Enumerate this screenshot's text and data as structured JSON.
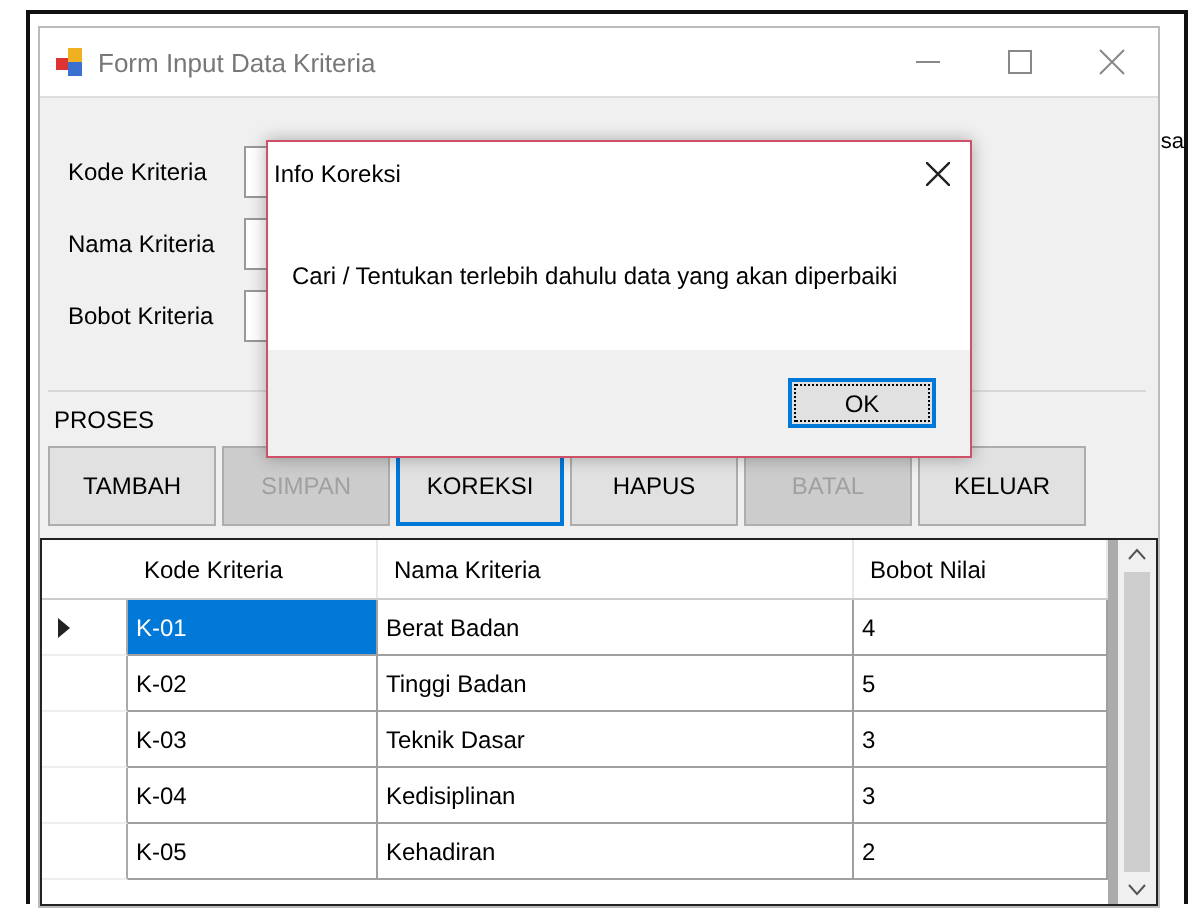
{
  "window": {
    "title": "Form Input Data Kriteria"
  },
  "background_text": "sa",
  "fields": [
    {
      "label": "Kode Kriteria"
    },
    {
      "label": "Nama Kriteria"
    },
    {
      "label": "Bobot Kriteria"
    }
  ],
  "group": {
    "title": "PROSES"
  },
  "buttons": [
    {
      "label": "TAMBAH",
      "disabled": false,
      "focused": false
    },
    {
      "label": "SIMPAN",
      "disabled": true,
      "focused": false
    },
    {
      "label": "KOREKSI",
      "disabled": false,
      "focused": true
    },
    {
      "label": "HAPUS",
      "disabled": false,
      "focused": false
    },
    {
      "label": "BATAL",
      "disabled": true,
      "focused": false
    },
    {
      "label": "KELUAR",
      "disabled": false,
      "focused": false
    }
  ],
  "table": {
    "columns": [
      "Kode Kriteria",
      "Nama Kriteria",
      "Bobot Nilai"
    ],
    "rows": [
      {
        "selected": true,
        "cells": [
          "K-01",
          "Berat Badan",
          "4"
        ]
      },
      {
        "selected": false,
        "cells": [
          "K-02",
          "Tinggi Badan",
          "5"
        ]
      },
      {
        "selected": false,
        "cells": [
          "K-03",
          "Teknik Dasar",
          "3"
        ]
      },
      {
        "selected": false,
        "cells": [
          "K-04",
          "Kedisiplinan",
          "3"
        ]
      },
      {
        "selected": false,
        "cells": [
          "K-05",
          "Kehadiran",
          "2"
        ]
      }
    ]
  },
  "dialog": {
    "title": "Info Koreksi",
    "message": "Cari / Tentukan terlebih dahulu data yang akan diperbaiki",
    "button": "OK"
  }
}
